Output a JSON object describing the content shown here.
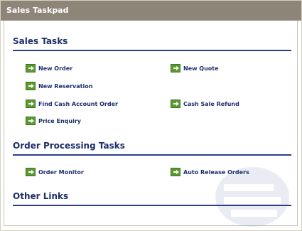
{
  "window": {
    "title": "Sales Taskpad"
  },
  "sections": {
    "sales": {
      "title": "Sales Tasks",
      "tasks": {
        "new_order": "New Order",
        "new_quote": "New Quote",
        "new_reservation": "New Reservation",
        "find_cash_account_order": "Find Cash Account Order",
        "cash_sale_refund": "Cash Sale Refund",
        "price_enquiry": "Price Enquiry"
      }
    },
    "order_processing": {
      "title": "Order Processing Tasks",
      "tasks": {
        "order_monitor": "Order Monitor",
        "auto_release_orders": "Auto Release Orders"
      }
    },
    "other": {
      "title": "Other Links"
    }
  },
  "icons": {
    "task_icon": "green-arrow-icon",
    "watermark": "logo-watermark"
  },
  "colors": {
    "titlebar": "#8e8579",
    "heading": "#1d2f6b",
    "rule": "#2a3f86",
    "icon": "#5b9a2e"
  }
}
